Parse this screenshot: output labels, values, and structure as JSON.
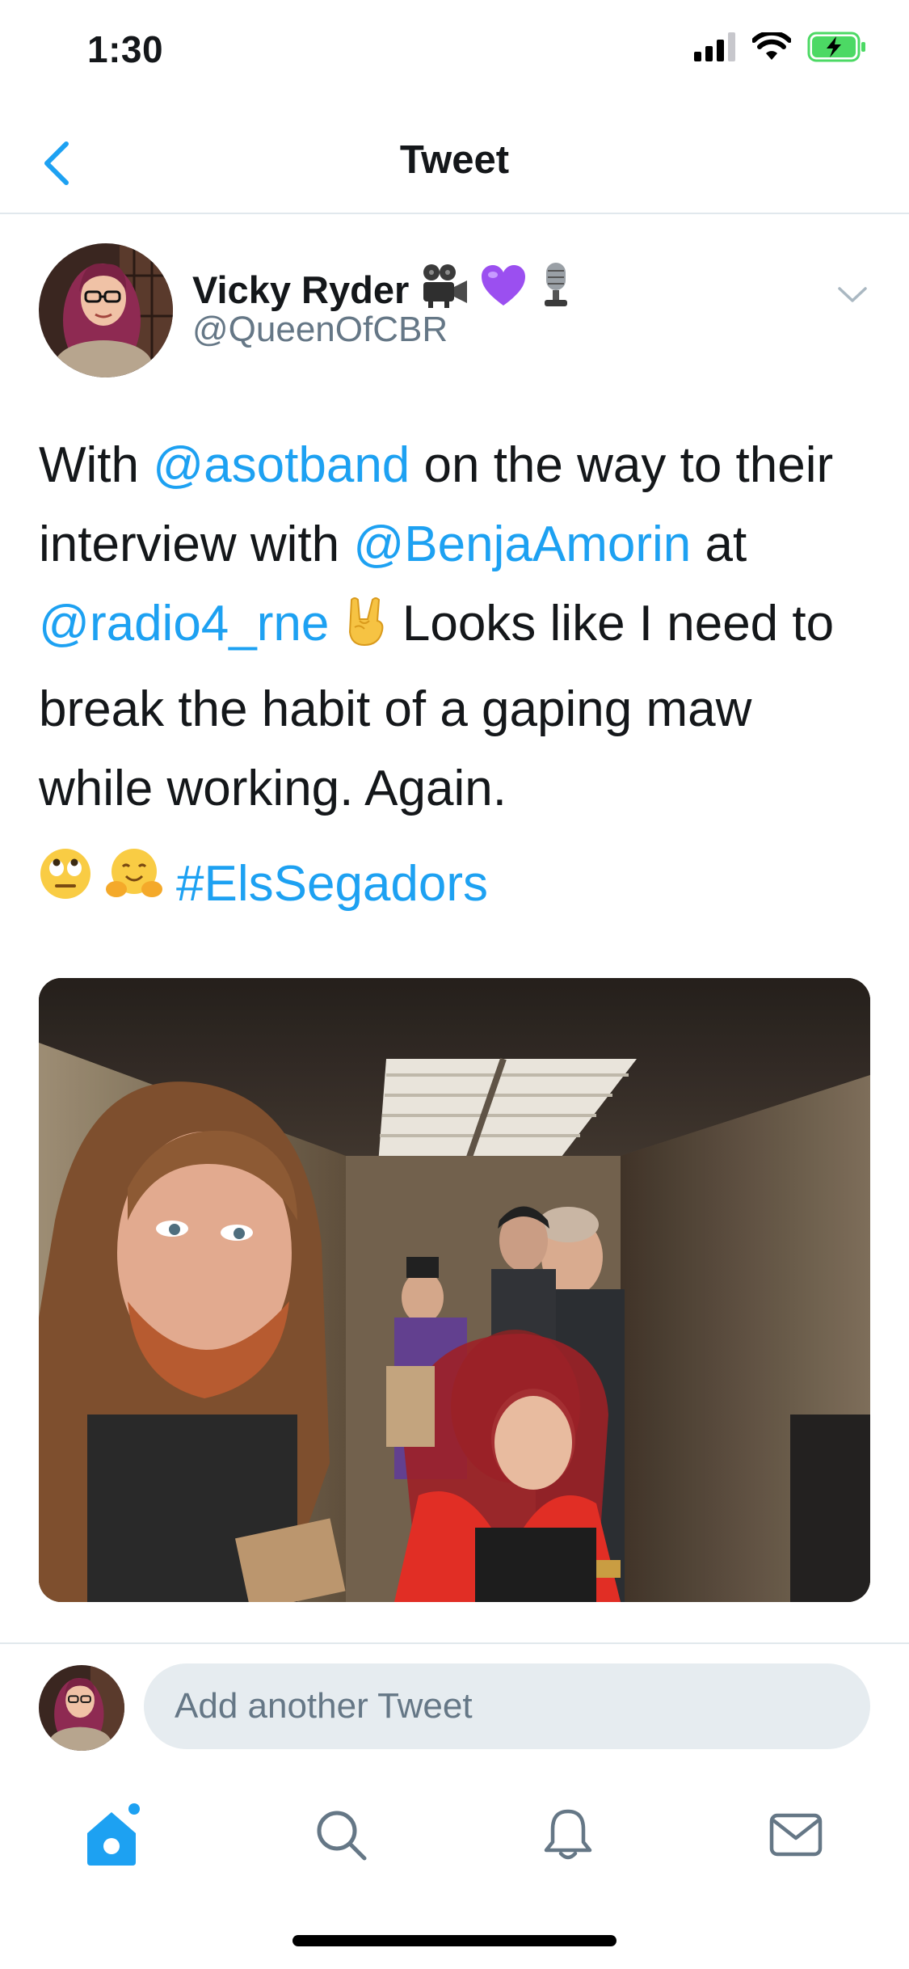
{
  "status_bar": {
    "time": "1:30"
  },
  "header": {
    "title": "Tweet"
  },
  "tweet": {
    "author_name": "Vicky Ryder",
    "author_handle": "@QueenOfCBR",
    "text": {
      "p1": "With ",
      "m1": "@asotband",
      "p2": " on the way to their interview with ",
      "m2": "@BenjaAmorin",
      "p3": " at ",
      "m3": "@radio4_rne",
      "p4": " Looks like I need to break the habit of a gaping maw while working. Again."
    },
    "hashtag": "#ElsSegadors"
  },
  "reply": {
    "placeholder": "Add another Tweet"
  },
  "colors": {
    "accent": "#1da1f2",
    "secondary_text": "#657786",
    "divider": "#e1e8ed",
    "battery": "#4cd964"
  },
  "icons": {
    "status": [
      "signal-icon",
      "wifi-icon",
      "battery-charging-icon"
    ],
    "name_emojis": [
      "movie-camera-icon",
      "purple-heart-icon",
      "microphone-icon"
    ],
    "inline_emoji": "rock-hand-icon",
    "tag_emojis": [
      "eye-roll-face-icon",
      "hugging-face-icon"
    ],
    "tabs": [
      "home-icon",
      "search-icon",
      "bell-icon",
      "mail-icon"
    ]
  }
}
